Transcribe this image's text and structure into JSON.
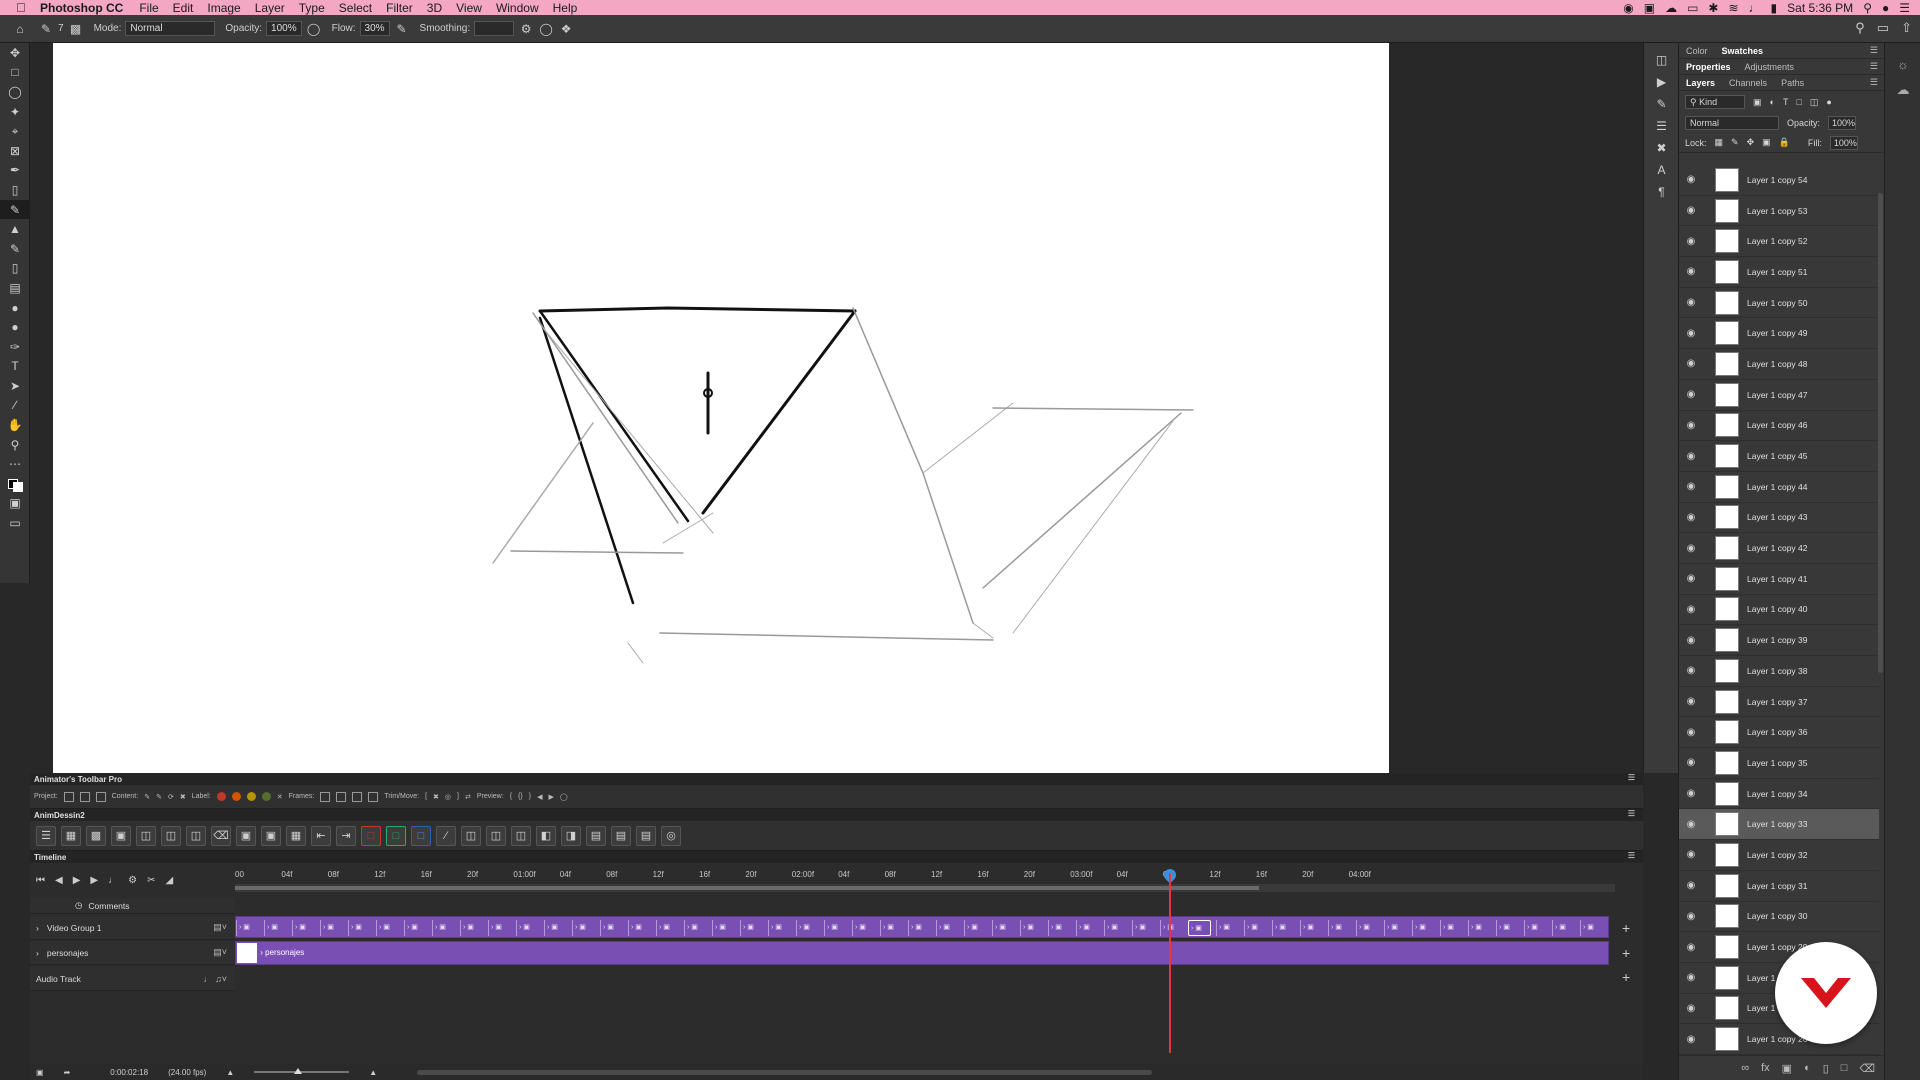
{
  "menubar": {
    "app_name": "Photoshop CC",
    "items": [
      "File",
      "Edit",
      "Image",
      "Layer",
      "Type",
      "Select",
      "Filter",
      "3D",
      "View",
      "Window",
      "Help"
    ],
    "clock": "Sat 5:36 PM"
  },
  "options_bar": {
    "mode_label": "Mode:",
    "mode_value": "Normal",
    "opacity_label": "Opacity:",
    "opacity_value": "100%",
    "flow_label": "Flow:",
    "flow_value": "30%",
    "smoothing_label": "Smoothing:",
    "smoothing_value": "",
    "brush_size": "7"
  },
  "panel": {
    "tabs_top": [
      "Color",
      "Swatches"
    ],
    "tabs_mid": [
      "Properties",
      "Adjustments"
    ],
    "tabs_layers": [
      "Layers",
      "Channels",
      "Paths"
    ],
    "filter_kind": "Kind",
    "blend_mode": "Normal",
    "opacity_label": "Opacity:",
    "opacity_value": "100%",
    "lock_label": "Lock:",
    "fill_label": "Fill:",
    "fill_value": "100%",
    "selected_layer": "Layer 1 copy 33",
    "layers": [
      "Layer 1 copy 54",
      "Layer 1 copy 53",
      "Layer 1 copy 52",
      "Layer 1 copy 51",
      "Layer 1 copy 50",
      "Layer 1 copy 49",
      "Layer 1 copy 48",
      "Layer 1 copy 47",
      "Layer 1 copy 46",
      "Layer 1 copy 45",
      "Layer 1 copy 44",
      "Layer 1 copy 43",
      "Layer 1 copy 42",
      "Layer 1 copy 41",
      "Layer 1 copy 40",
      "Layer 1 copy 39",
      "Layer 1 copy 38",
      "Layer 1 copy 37",
      "Layer 1 copy 36",
      "Layer 1 copy 35",
      "Layer 1 copy 34",
      "Layer 1 copy 33",
      "Layer 1 copy 32",
      "Layer 1 copy 31",
      "Layer 1 copy 30",
      "Layer 1 copy 29",
      "Layer 1 copy 28",
      "Layer 1 copy 27",
      "Layer 1 copy 26"
    ]
  },
  "animators_toolbar": {
    "title": "Animator's Toolbar Pro",
    "project_label": "Project:",
    "content_label": "Content:",
    "label_label": "Label:",
    "frames_label": "Frames:",
    "trim_label": "Trim/Move:",
    "preview_label": "Preview:",
    "label_colors": [
      "#c0392b",
      "#d35400",
      "#b7950b",
      "#556b2f"
    ]
  },
  "anim_panel": {
    "title": "AnimDessin2"
  },
  "timeline": {
    "title": "Timeline",
    "ruler": [
      "00",
      "04f",
      "08f",
      "12f",
      "16f",
      "20f",
      "01:00f",
      "04f",
      "08f",
      "12f",
      "16f",
      "20f",
      "02:00f",
      "04f",
      "08f",
      "12f",
      "16f",
      "20f",
      "03:00f",
      "04f",
      "08f",
      "12f",
      "16f",
      "20f",
      "04:00f"
    ],
    "comments": "Comments",
    "video_group": "Video Group 1",
    "personajes": "personajes",
    "audio": "Audio Track",
    "timecode": "0:00:02:18",
    "fps": "(24.00 fps)",
    "clip_count": 49,
    "current_clip": 34
  }
}
